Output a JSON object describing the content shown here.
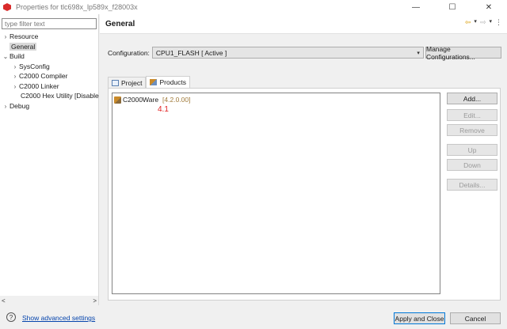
{
  "window": {
    "title": "Properties for tlc698x_lp589x_f28003x",
    "minimize_glyph": "—",
    "maximize_glyph": "☐",
    "close_glyph": "✕"
  },
  "sidebar": {
    "filter_placeholder": "type filter text",
    "items": [
      {
        "label": "Resource",
        "chevron": "›"
      },
      {
        "label": "General",
        "chevron": ""
      },
      {
        "label": "Build",
        "chevron": "⌄"
      },
      {
        "label": "SysConfig",
        "chevron": "›"
      },
      {
        "label": "C2000 Compiler",
        "chevron": "›"
      },
      {
        "label": "C2000 Linker",
        "chevron": "›"
      },
      {
        "label": "C2000 Hex Utility  [Disable",
        "chevron": ""
      },
      {
        "label": "Debug",
        "chevron": "›"
      }
    ],
    "scroll_left": "<",
    "scroll_right": ">"
  },
  "main": {
    "title": "General",
    "nav": {
      "back": "⇦",
      "back_menu": "▾",
      "forward": "⇨",
      "forward_menu": "▾",
      "more": "⋮"
    },
    "configuration": {
      "label": "Configuration:",
      "value": "CPU1_FLASH  [ Active ]",
      "manage_button": "Manage Configurations..."
    },
    "tabs": [
      {
        "label": "Project",
        "icon": "project-icon"
      },
      {
        "label": "Products",
        "icon": "products-icon"
      }
    ],
    "products": [
      {
        "name": "C2000Ware",
        "version": "[4.2.0.00]",
        "icon": "c2000ware-icon"
      }
    ],
    "annotation": "4.1",
    "side_buttons": {
      "add": "Add...",
      "edit": "Edit...",
      "remove": "Remove",
      "up": "Up",
      "down": "Down",
      "details": "Details..."
    }
  },
  "footer": {
    "help_glyph": "?",
    "advanced_link": "Show advanced settings",
    "apply_close": "Apply and Close",
    "cancel": "Cancel"
  },
  "colors": {
    "accent": "#0078d7",
    "annotation": "#e02020",
    "link": "#0645ad"
  }
}
